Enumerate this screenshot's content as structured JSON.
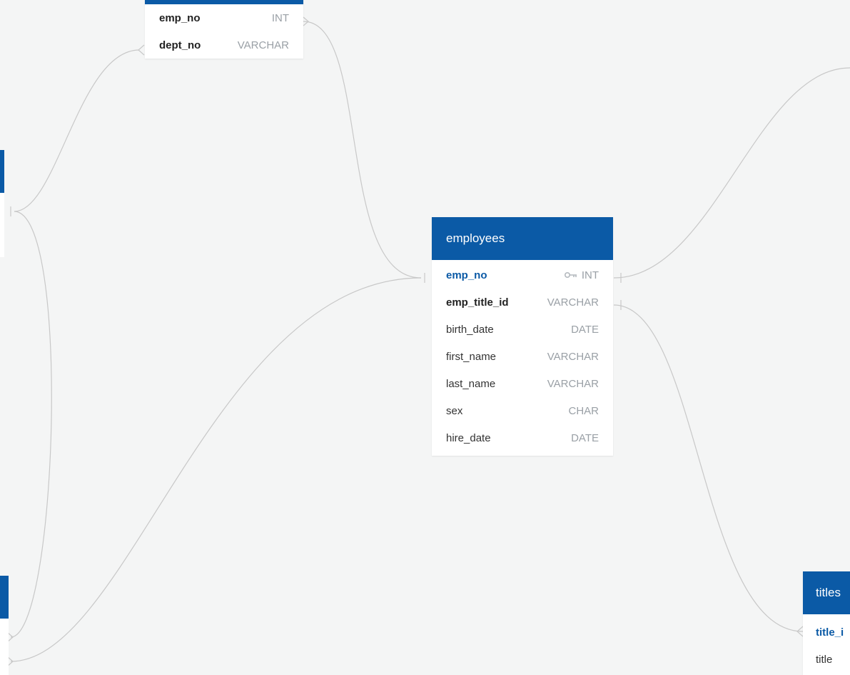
{
  "colors": {
    "header": "#0b5aa6",
    "line": "#c8c8c8",
    "canvas": "#f4f5f5"
  },
  "dept_emp": {
    "rows": [
      {
        "name": "emp_no",
        "type": "INT"
      },
      {
        "name": "dept_no",
        "type": "VARCHAR"
      }
    ]
  },
  "employees": {
    "title": "employees",
    "rows": [
      {
        "name": "emp_no",
        "type": "INT",
        "icon": "key-icon"
      },
      {
        "name": "emp_title_id",
        "type": "VARCHAR"
      },
      {
        "name": "birth_date",
        "type": "DATE"
      },
      {
        "name": "first_name",
        "type": "VARCHAR"
      },
      {
        "name": "last_name",
        "type": "VARCHAR"
      },
      {
        "name": "sex",
        "type": "CHAR"
      },
      {
        "name": "hire_date",
        "type": "DATE"
      }
    ]
  },
  "titles": {
    "title": "titles",
    "rows": [
      {
        "name": "title_i"
      },
      {
        "name": "title"
      }
    ]
  }
}
